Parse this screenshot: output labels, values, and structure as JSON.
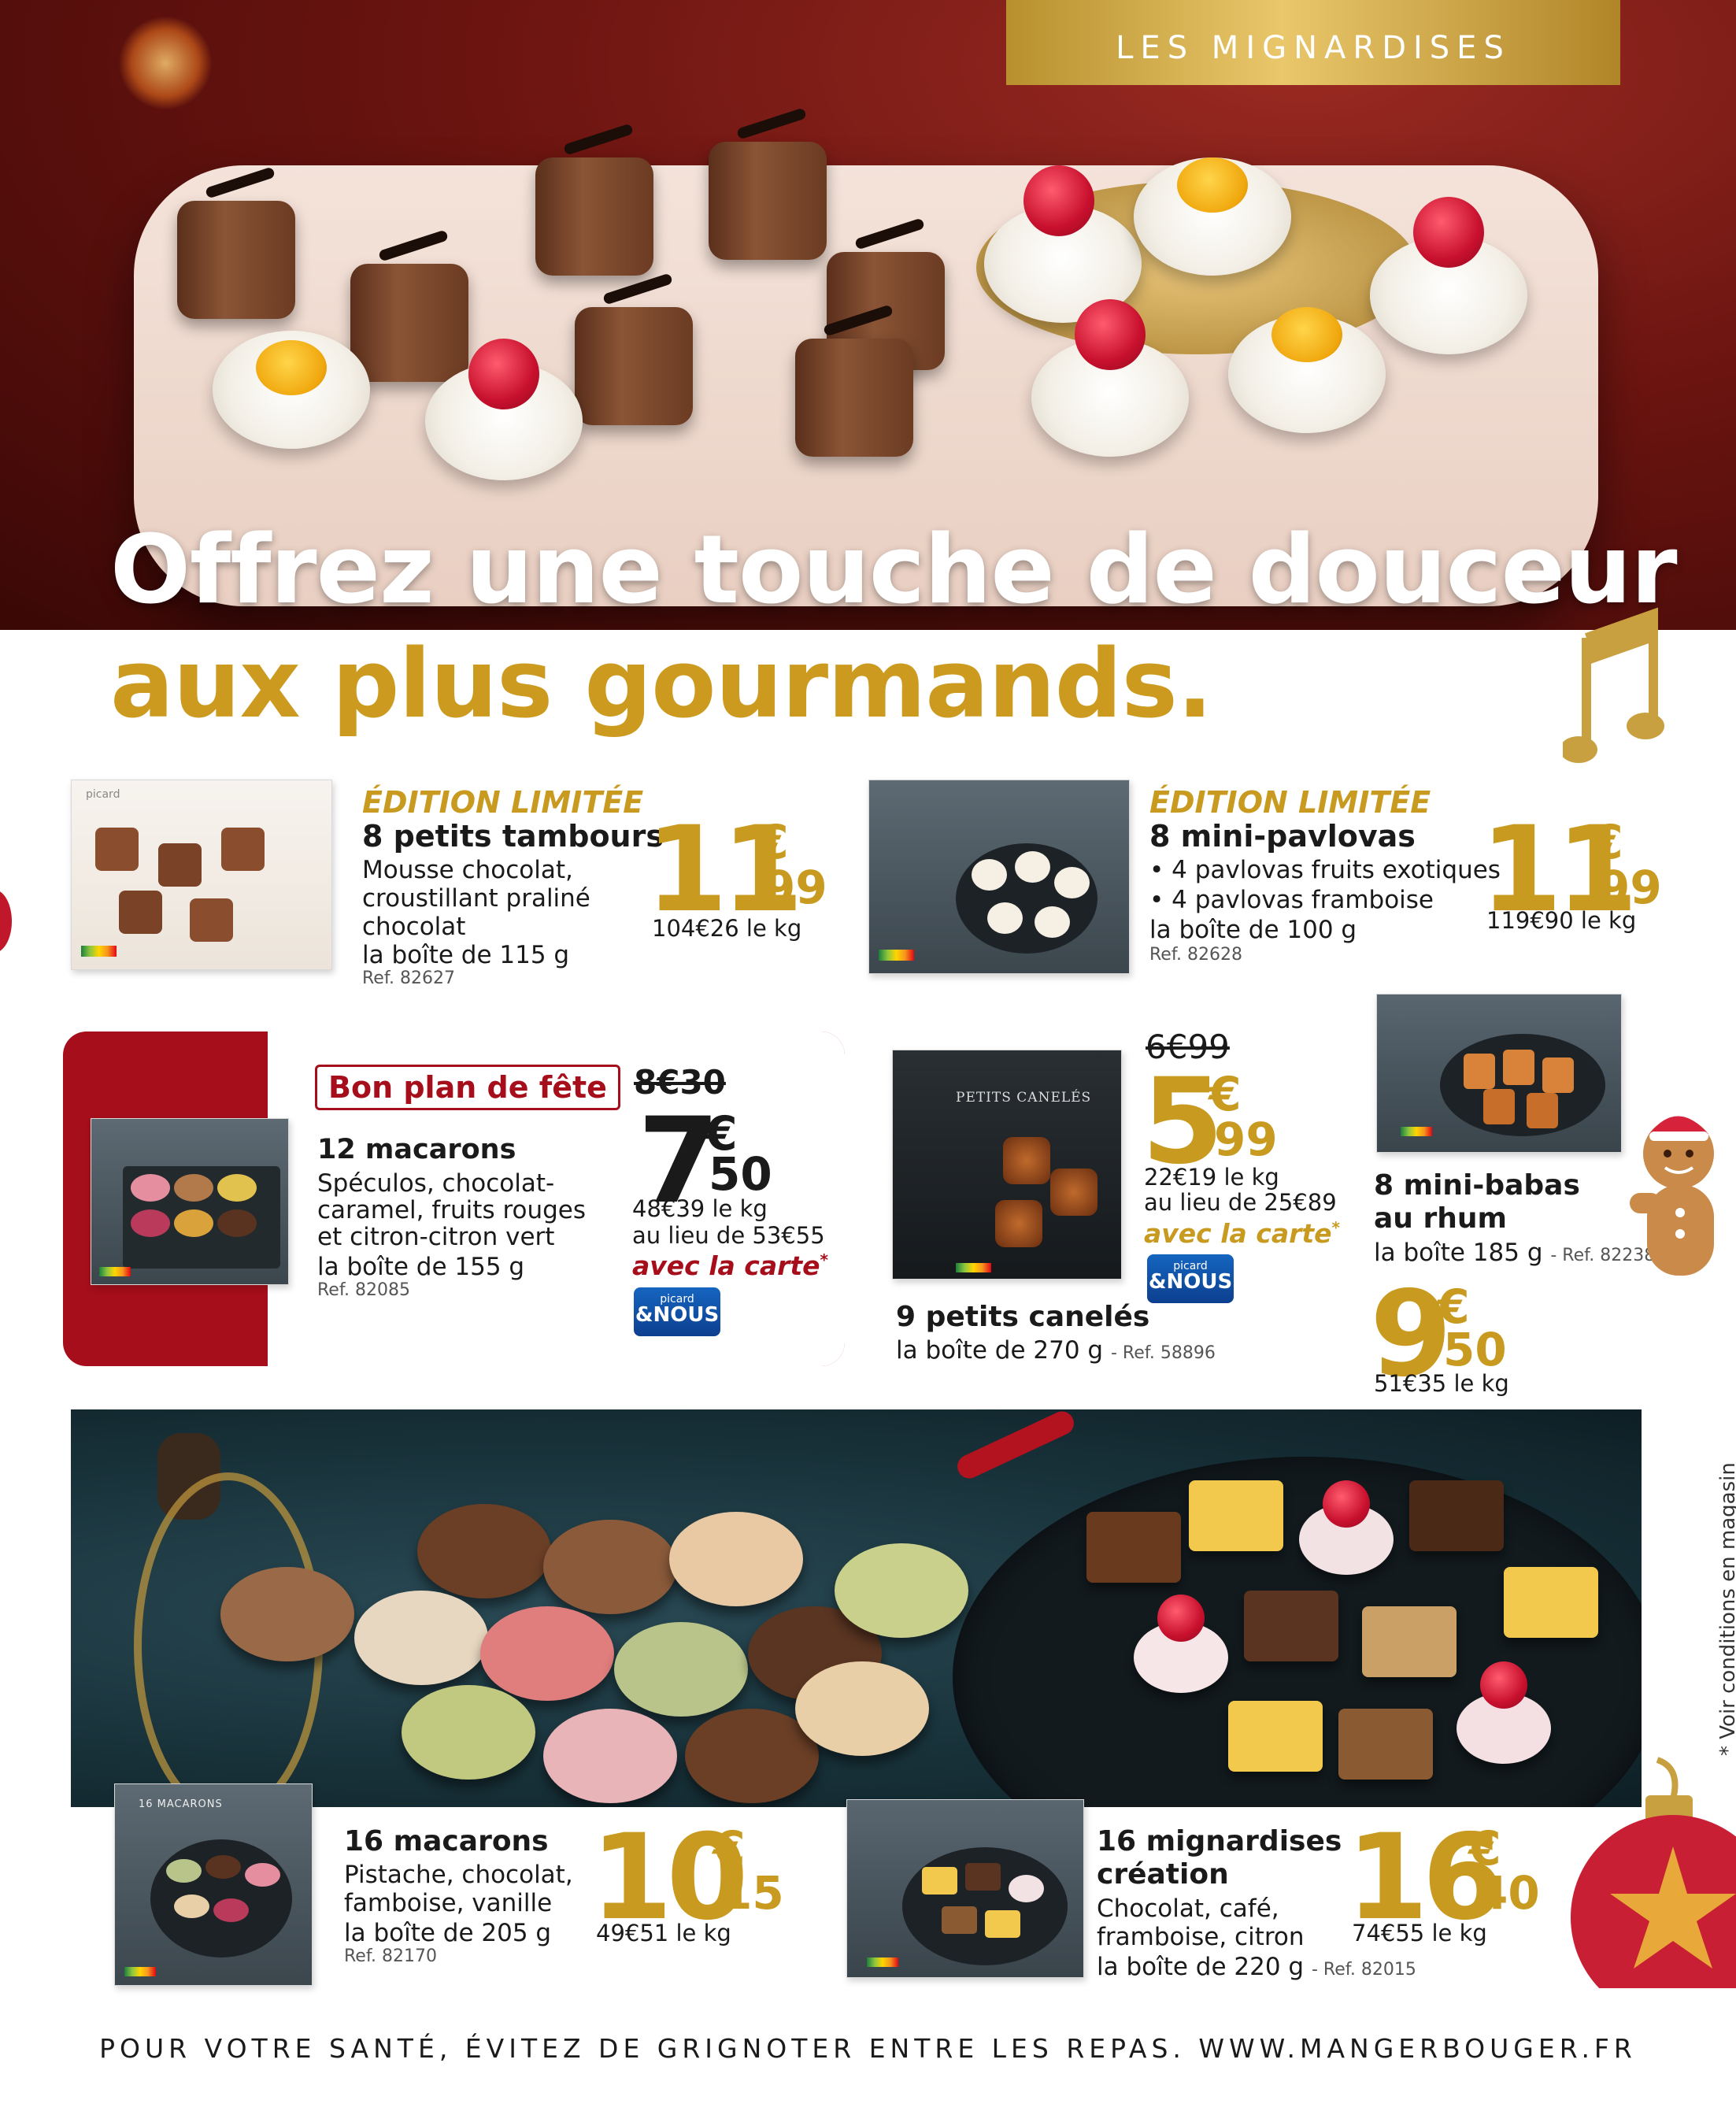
{
  "header": {
    "section_label": "LES MIGNARDISES",
    "headline_line1": "Offrez une touche de douceur",
    "headline_line2": "aux plus gourmands."
  },
  "colors": {
    "gold": "#c89a1f",
    "red": "#a50e1a",
    "carte_blue": "#1565c0"
  },
  "products": {
    "tambours": {
      "tag": "ÉDITION LIMITÉE",
      "name": "8 petits tambours",
      "desc1": "Mousse chocolat,",
      "desc2": "croustillant praliné",
      "desc3": "chocolat",
      "weight": "la boîte de 115 g",
      "ref": "Ref. 82627",
      "price_units": "11",
      "price_currency": "€",
      "price_cents": "99",
      "price_per_kg": "104€26 le kg",
      "box_brand": "picard"
    },
    "pavlovas": {
      "tag": "ÉDITION LIMITÉE",
      "name": "8 mini-pavlovas",
      "bullet1": "• 4 pavlovas fruits exotiques",
      "bullet2": "• 4 pavlovas framboise",
      "weight": "la boîte de 100 g",
      "ref": "Ref. 82628",
      "price_units": "11",
      "price_currency": "€",
      "price_cents": "99",
      "price_per_kg": "119€90 le kg"
    },
    "macarons12": {
      "badge": "Bon plan de fête",
      "old_price": "8€30",
      "name": "12 macarons",
      "desc1": "Spéculos, chocolat-",
      "desc2": "caramel, fruits rouges",
      "desc3": "et citron-citron vert",
      "weight": "la boîte de 155 g",
      "ref": "Ref. 82085",
      "price_units": "7",
      "price_currency": "€",
      "price_cents": "50",
      "price_per_kg": "48€39 le kg",
      "instead_of": "au lieu de 53€55",
      "with_card": "avec la carte",
      "asterisk": "*",
      "card_top": "picard",
      "card_bottom": "&NOUS"
    },
    "canneles": {
      "old_price": "6€99",
      "price_units": "5",
      "price_currency": "€",
      "price_cents": "99",
      "price_per_kg": "22€19 le kg",
      "instead_of": "au lieu de 25€89",
      "with_card": "avec la carte",
      "asterisk": "*",
      "card_top": "picard",
      "card_bottom": "&NOUS",
      "name": "9 petits canelés",
      "weight": "la boîte de 270 g",
      "ref": "- Ref. 58896",
      "box_label": "PETITS CANELÉS"
    },
    "babas": {
      "name_line1": "8 mini-babas",
      "name_line2": "au rhum",
      "weight": "la boîte 185 g",
      "ref": "- Ref. 82238",
      "price_units": "9",
      "price_currency": "€",
      "price_cents": "50",
      "price_per_kg": "51€35 le kg"
    },
    "macarons16": {
      "name": "16 macarons",
      "desc1": "Pistache, chocolat,",
      "desc2": "famboise, vanille",
      "weight": "la boîte de 205 g",
      "ref": "Ref. 82170",
      "price_units": "10",
      "price_currency": "€",
      "price_cents": "15",
      "price_per_kg": "49€51 le kg",
      "box_label": "16 MACARONS"
    },
    "mignardises16": {
      "name_line1": "16 mignardises",
      "name_line2": "création",
      "desc1": "Chocolat, café,",
      "desc2": "framboise, citron",
      "weight": "la boîte de 220 g",
      "ref": "- Ref. 82015",
      "price_units": "16",
      "price_currency": "€",
      "price_cents": "40",
      "price_per_kg": "74€55 le kg"
    }
  },
  "side_note": "* Voir conditions en magasin",
  "footer": "POUR VOTRE SANTÉ, ÉVITEZ DE GRIGNOTER ENTRE LES REPAS. WWW.MANGERBOUGER.FR"
}
